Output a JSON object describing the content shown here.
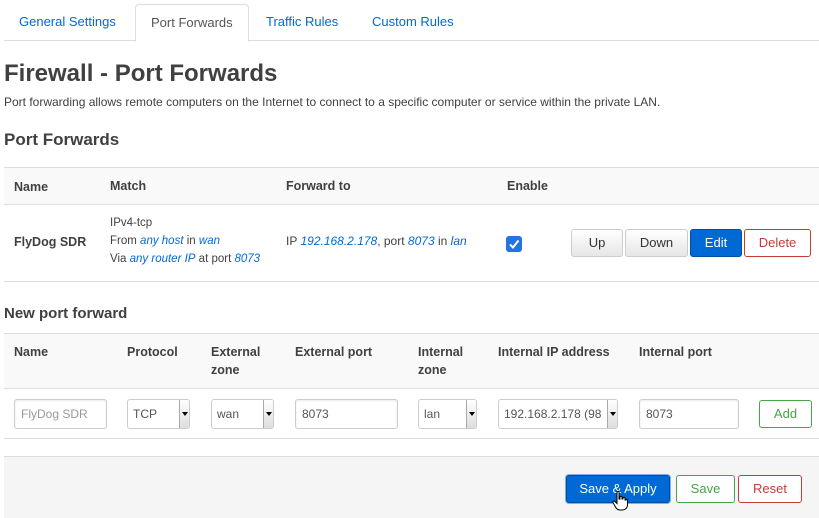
{
  "tabs": [
    {
      "label": "General Settings",
      "active": false
    },
    {
      "label": "Port Forwards",
      "active": true
    },
    {
      "label": "Traffic Rules",
      "active": false
    },
    {
      "label": "Custom Rules",
      "active": false
    }
  ],
  "page": {
    "title": "Firewall - Port Forwards",
    "description": "Port forwarding allows remote computers on the Internet to connect to a specific computer or service within the private LAN."
  },
  "port_forwards": {
    "section_title": "Port Forwards",
    "columns": [
      "Name",
      "Match",
      "Forward to",
      "Enable"
    ],
    "rows": [
      {
        "name": "FlyDog SDR",
        "match_line1": "IPv4-tcp",
        "match_from_prefix": "From",
        "match_from_host": "any host",
        "match_in": "in",
        "match_from_zone": "wan",
        "match_via_prefix": "Via",
        "match_via_ip": "any router IP",
        "match_at_port": "at port",
        "match_port": "8073",
        "fwd_prefix": "IP",
        "fwd_ip": "192.168.2.178",
        "fwd_port_label": ", port",
        "fwd_port": "8073",
        "fwd_in": "in",
        "fwd_zone": "lan",
        "enabled": true,
        "buttons": {
          "up": "Up",
          "down": "Down",
          "edit": "Edit",
          "delete": "Delete"
        }
      }
    ]
  },
  "new_forward": {
    "section_title": "New port forward",
    "columns": {
      "name": "Name",
      "protocol": "Protocol",
      "ext_zone_1": "External",
      "ext_zone_2": "zone",
      "ext_port": "External port",
      "int_zone_1": "Internal",
      "int_zone_2": "zone",
      "int_ip": "Internal IP address",
      "int_port": "Internal port"
    },
    "inputs": {
      "name_placeholder": "FlyDog SDR",
      "protocol": "TCP",
      "ext_zone": "wan",
      "ext_port": "8073",
      "int_zone": "lan",
      "int_ip": "192.168.2.178 (98",
      "int_port": "8073"
    },
    "add_label": "Add"
  },
  "footer": {
    "save_apply": "Save & Apply",
    "save": "Save",
    "reset": "Reset"
  },
  "colors": {
    "link": "#0069d6",
    "primary": "#0069d6",
    "danger": "#c43c35",
    "success": "#46a546"
  }
}
